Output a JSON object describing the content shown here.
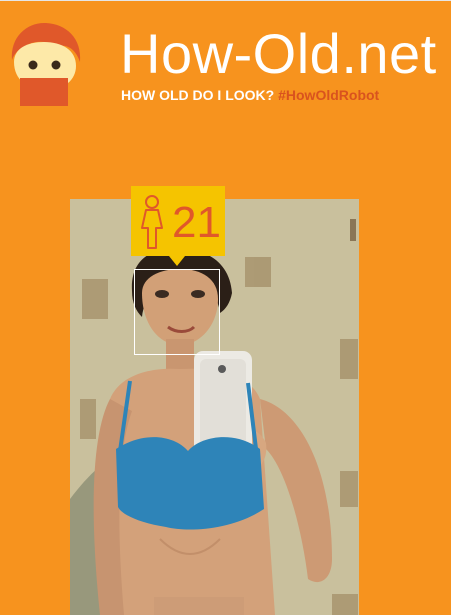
{
  "header": {
    "title": "How-Old.net",
    "tagline": "HOW OLD DO I LOOK?",
    "hashtag": "#HowOldRobot"
  },
  "result": {
    "gender_icon": "female-icon",
    "age": "21"
  },
  "colors": {
    "background": "#f7931e",
    "badge": "#f5c400",
    "accent": "#d9531e"
  }
}
